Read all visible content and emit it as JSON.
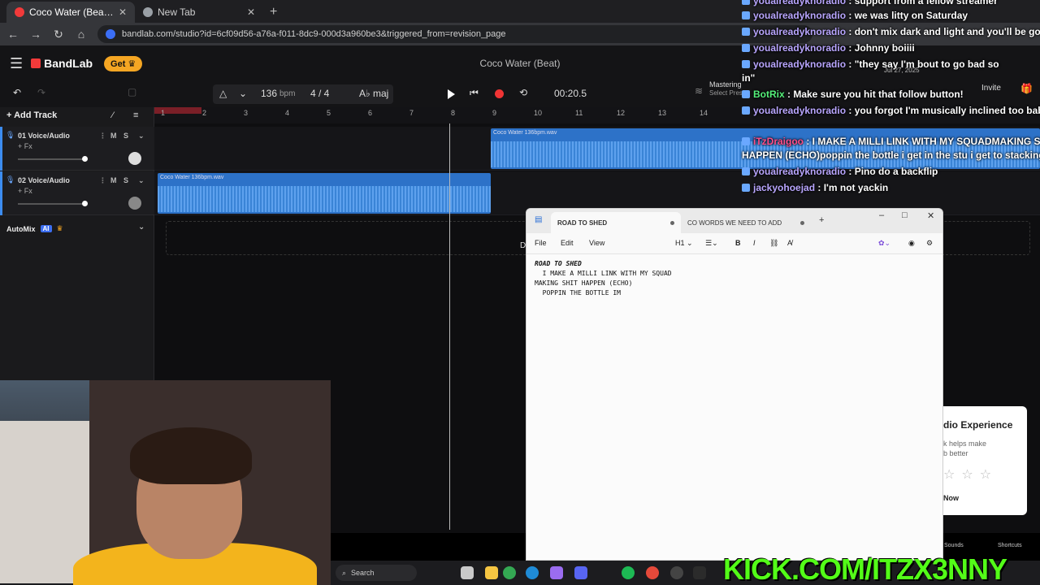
{
  "browser": {
    "tabs": [
      {
        "label": "Coco Water (Beat) - Studio",
        "active": true
      },
      {
        "label": "New Tab",
        "active": false
      }
    ],
    "url": "bandlab.com/studio?id=6cf09d56-a76a-f011-8dc9-000d3a960be3&triggered_from=revision_page"
  },
  "bandlab": {
    "logo": "BandLab",
    "get_label": "Get",
    "project_title": "Coco Water (Beat)",
    "bpm_value": "136",
    "bpm_unit": "bpm",
    "time_signature": "4 / 4",
    "key": "A♭ maj",
    "time_display": "00:20.5",
    "mastering_label": "Mastering",
    "mastering_sub": "Select Pres",
    "invite_label": "Invite",
    "add_track_label": "Add Track",
    "tracks": [
      {
        "name": "01  Voice/Audio",
        "fx": "+ Fx"
      },
      {
        "name": "02  Voice/Audio",
        "fx": "+ Fx"
      }
    ],
    "mute_label": "M",
    "solo_label": "S",
    "automix_label": "AutoMix",
    "ai_badge": "AI",
    "ruler": [
      "1",
      "2",
      "3",
      "4",
      "5",
      "6",
      "7",
      "8",
      "9",
      "10",
      "11",
      "12",
      "13",
      "14"
    ],
    "clips": [
      {
        "label": "Coco Water 136bpm.wav"
      },
      {
        "label": "Coco Water 136bpm.wav"
      }
    ],
    "drop_hint": "D",
    "bottom_sounds": "Sounds",
    "bottom_shortcuts": "Shortcuts"
  },
  "chat": [
    {
      "user": "youalreadyknoradio",
      "text": " : support from a fellow streamer"
    },
    {
      "user": "youalreadyknoradio",
      "text": " : we was litty on Saturday"
    },
    {
      "user": "youalreadyknoradio",
      "text": " : don't mix dark and light and you'll be good"
    },
    {
      "user": "youalreadyknoradio",
      "text": " : Johnny boiiii"
    },
    {
      "user": "youalreadyknoradio",
      "text": " : \"they say I'm bout to go bad so"
    },
    {
      "user": "",
      "text": "in\""
    },
    {
      "user": "BotRix",
      "text": " : Make sure you hit that follow button!"
    },
    {
      "user": "youalreadyknoradio",
      "text": " : you forgot I'm musically inclined too baby boy"
    },
    {
      "user": "iTzDraigoo",
      "text": " : I MAKE A MILLI LINK WITH MY SQUADMAKING SHIT"
    },
    {
      "user": "",
      "text": "HAPPEN (ECHO)poppin the bottle i get in the stu i get to stacking"
    },
    {
      "user": "youalreadyknoradio",
      "text": " : Pino do a backflip"
    },
    {
      "user": "jackyohoejad",
      "text": " : I'm not yackin"
    }
  ],
  "notepad": {
    "tabs": [
      "ROAD TO SHED",
      "CO WORDS WE NEED TO ADD"
    ],
    "menu": [
      "File",
      "Edit",
      "View"
    ],
    "heading_label": "H1",
    "lines": [
      "ROAD TO SHED",
      "  I MAKE A MILLI LINK WITH MY SQUAD",
      "MAKING SHIT HAPPEN (ECHO)",
      "  POPPIN THE BOTTLE IM"
    ]
  },
  "rating": {
    "title": "dio Experience",
    "body": "k helps make\nb better",
    "stars": "☆☆☆",
    "cta": "Now"
  },
  "taskbar": {
    "search_placeholder": "Search"
  },
  "stream": {
    "kick": "KICK.COM/ITZX3NNY",
    "date": "Jul 27, 2025"
  }
}
